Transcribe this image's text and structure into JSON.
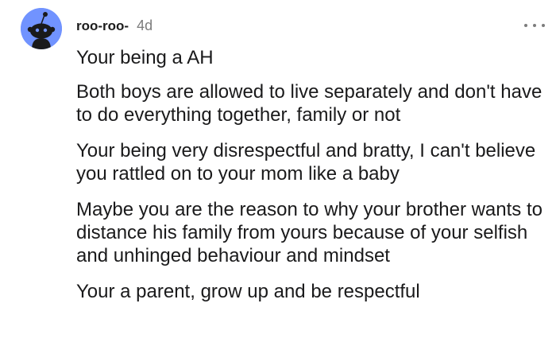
{
  "comment": {
    "username": "roo-roo-",
    "timestamp": "4d",
    "paragraphs": [
      "Your being a AH",
      "Both boys are allowed to live separately and don't have to do everything together, family or not",
      "Your being very disrespectful and bratty, I can't believe you rattled on to your mom like a baby",
      "Maybe you are the reason to why your brother wants to distance his family from yours because of your selfish and unhinged behaviour and mindset",
      "Your a parent, grow up and be respectful"
    ]
  },
  "colors": {
    "avatar_bg": "#7193ff",
    "text": "#1a1a1b",
    "muted": "#7c7c7c"
  },
  "icons": {
    "avatar": "reddit-snoo-avatar-icon",
    "more": "more-options-icon"
  }
}
